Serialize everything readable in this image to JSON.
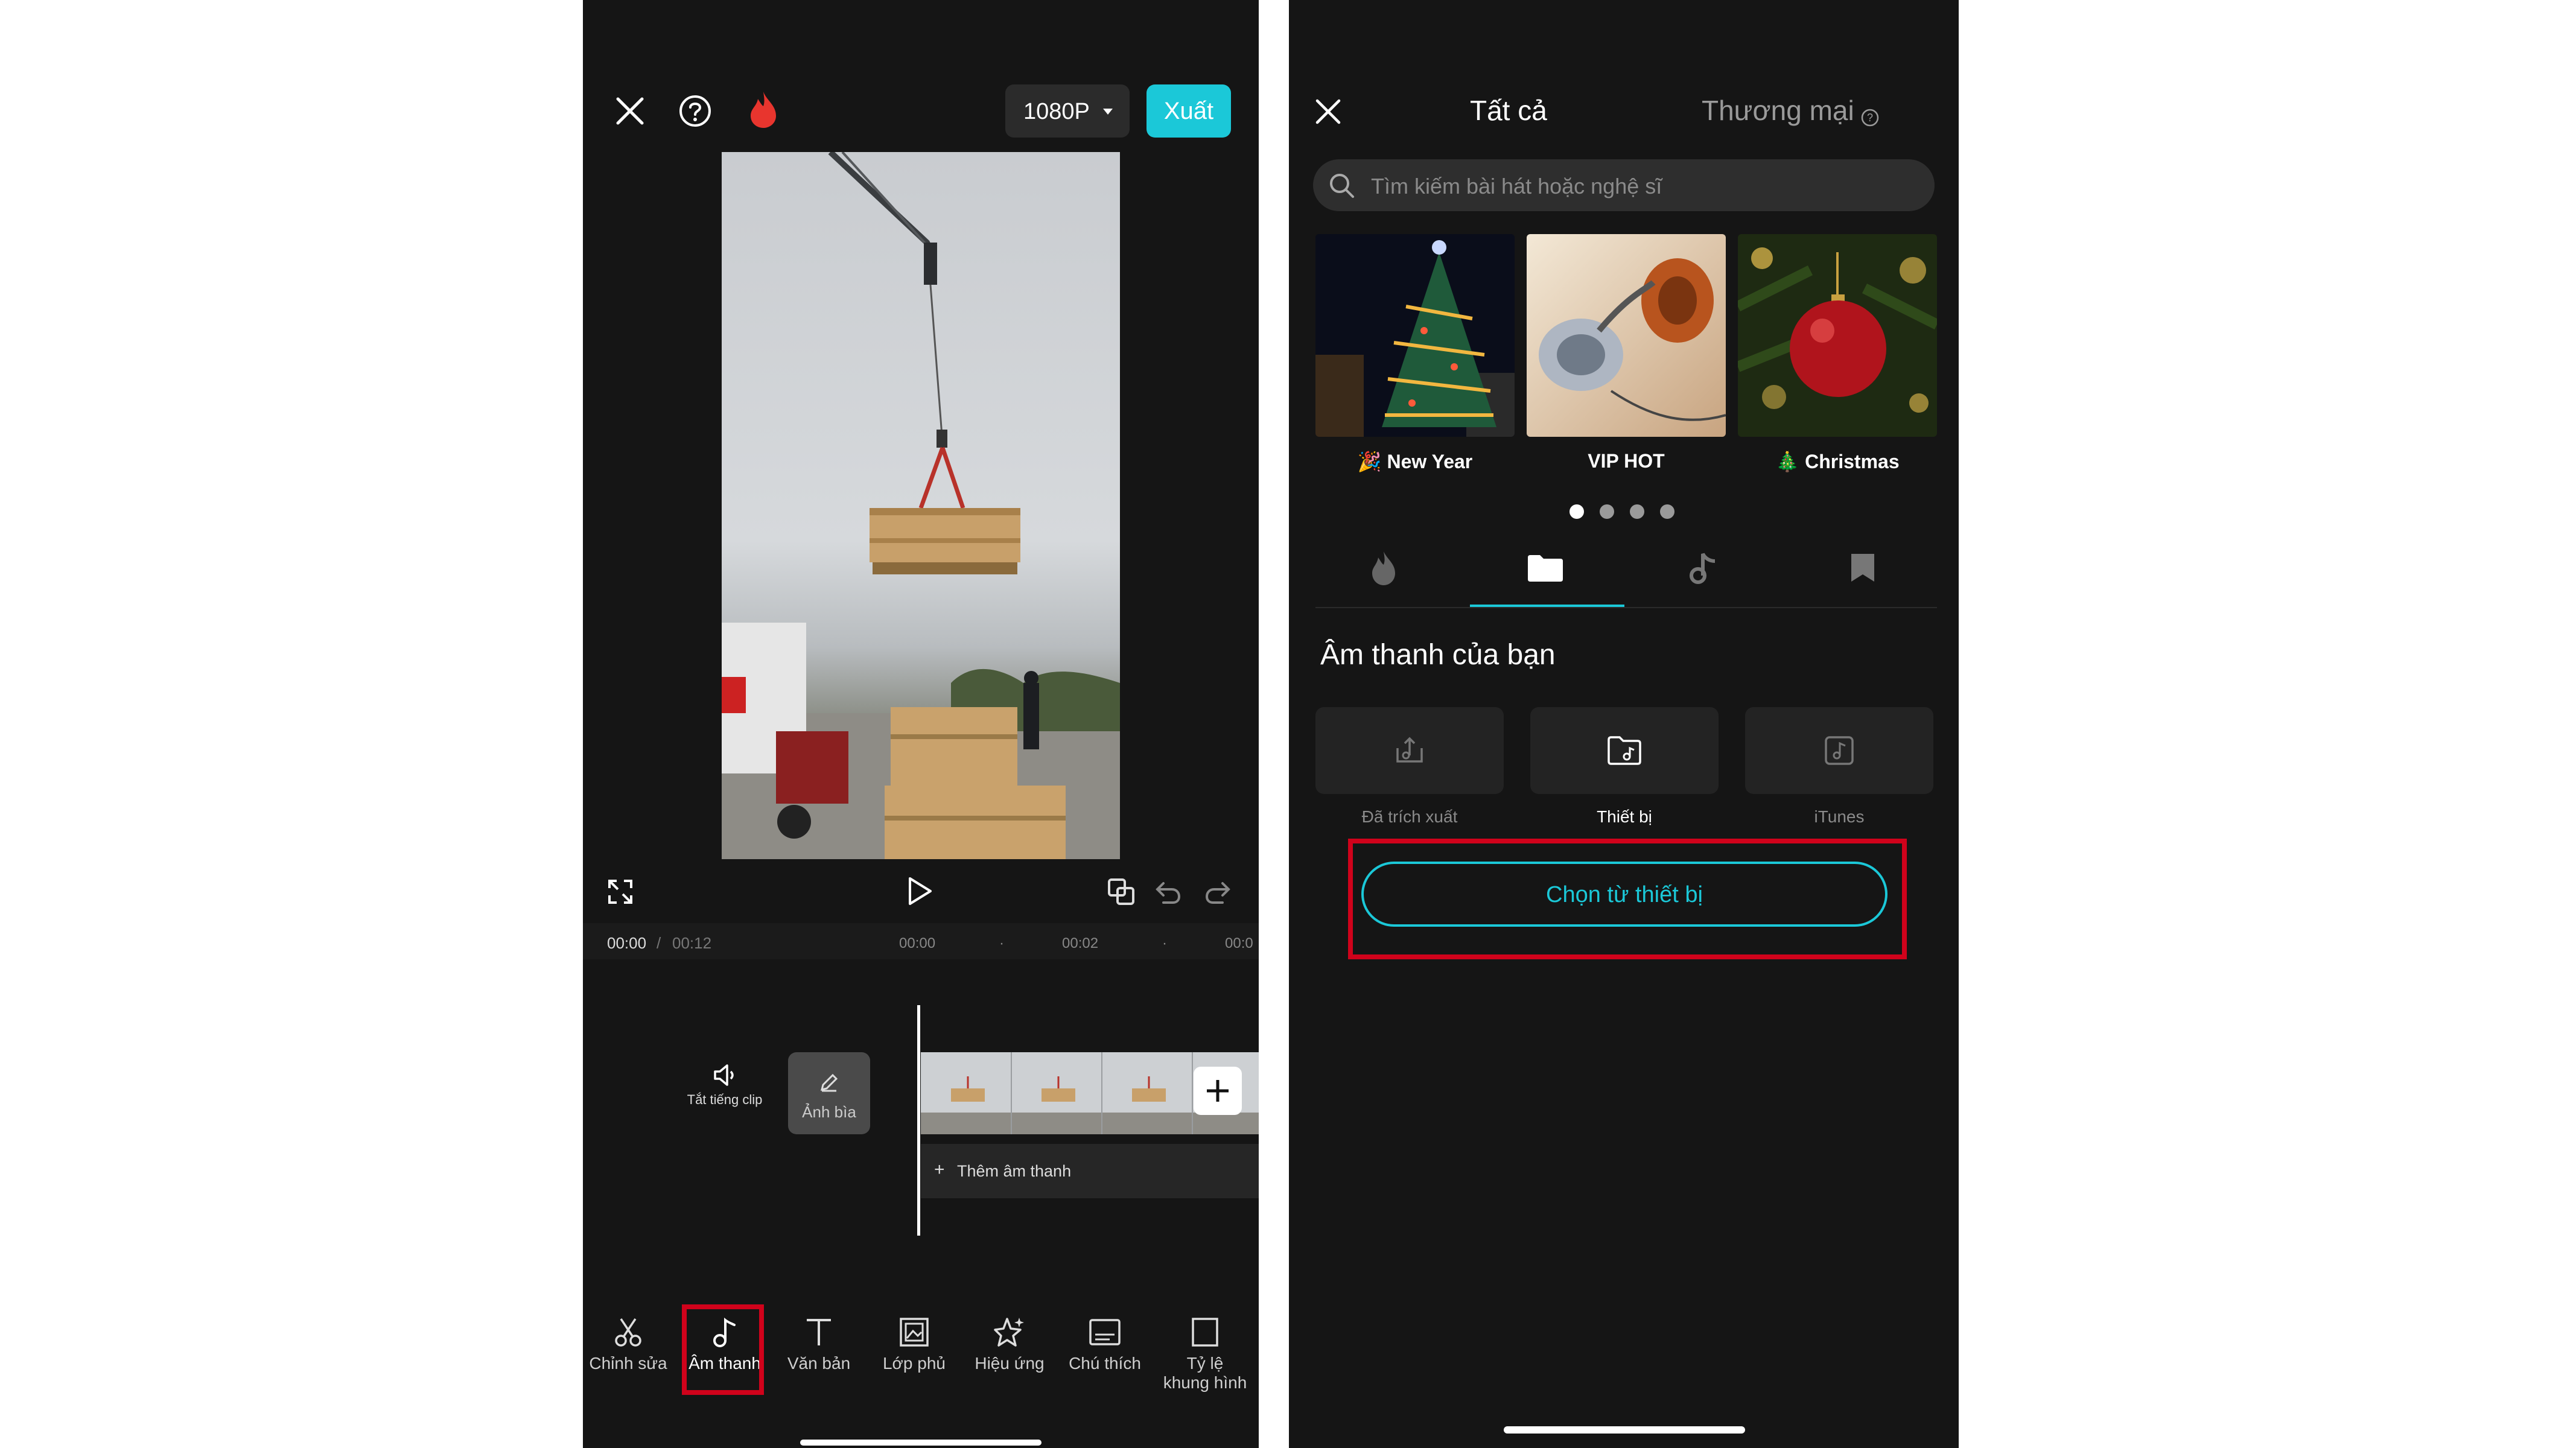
{
  "editor": {
    "resolution": "1080P",
    "export_label": "Xuất",
    "time_current": "00:00",
    "time_sep": "/",
    "time_total": "00:12",
    "ruler": [
      "00:00",
      "00:02",
      "00:0"
    ],
    "mute_label": "Tắt tiếng clip",
    "cover_label": "Ảnh bìa",
    "add_audio_label": "Thêm âm thanh",
    "tools": [
      {
        "label": "Chỉnh sửa",
        "icon": "scissors-icon"
      },
      {
        "label": "Âm thanh",
        "icon": "music-note-icon"
      },
      {
        "label": "Văn bản",
        "icon": "text-icon"
      },
      {
        "label": "Lớp phủ",
        "icon": "overlay-icon"
      },
      {
        "label": "Hiệu ứng",
        "icon": "effects-star-icon"
      },
      {
        "label": "Chú thích",
        "icon": "captions-icon"
      },
      {
        "label": "Tỷ lệ",
        "label2": "khung hình",
        "icon": "aspect-ratio-icon"
      }
    ]
  },
  "music": {
    "tab_all": "Tất cả",
    "tab_commercial": "Thương mại",
    "search_placeholder": "Tìm kiếm bài hát hoặc nghệ sĩ",
    "cards": [
      {
        "emoji": "🎉",
        "label": "New Year"
      },
      {
        "emoji": "",
        "label": "VIP HOT"
      },
      {
        "emoji": "🎄",
        "label": "Christmas"
      }
    ],
    "section_title": "Âm thanh của bạn",
    "sources": [
      {
        "label": "Đã trích xuất",
        "icon": "extract-icon"
      },
      {
        "label": "Thiết bị",
        "icon": "device-folder-icon"
      },
      {
        "label": "iTunes",
        "icon": "itunes-icon"
      }
    ],
    "choose_button": "Chọn từ thiết bị"
  },
  "colors": {
    "accent": "#1bc8d8",
    "highlight": "#d0021b",
    "background": "#151515",
    "flame": "#e8352e"
  }
}
